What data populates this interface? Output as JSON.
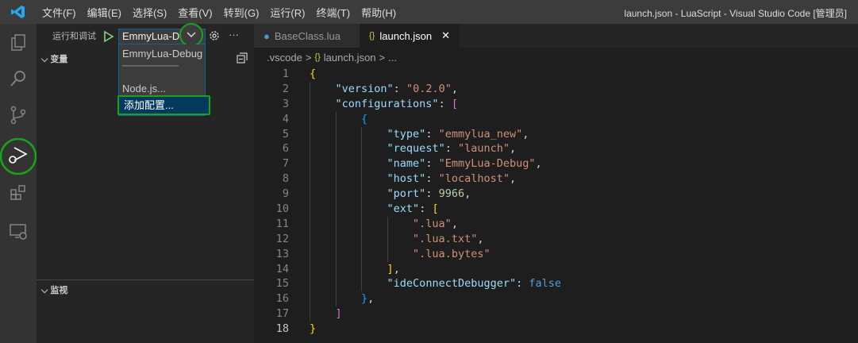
{
  "titlebar": {
    "menu": [
      "文件(F)",
      "编辑(E)",
      "选择(S)",
      "查看(V)",
      "转到(G)",
      "运行(R)",
      "终端(T)",
      "帮助(H)"
    ],
    "title": "launch.json - LuaScript - Visual Studio Code [管理员]"
  },
  "sidebar": {
    "title": "运行和调试",
    "config": "EmmyLua-Debug",
    "dropdown": {
      "items": [
        "EmmyLua-Debug",
        "──────────",
        "Node.js...",
        "添加配置..."
      ]
    },
    "more": "···",
    "variables": "变量",
    "watch": "监视"
  },
  "tabs": [
    {
      "label": "BaseClass.lua"
    },
    {
      "label": "launch.json",
      "close": "✕"
    }
  ],
  "breadcrumb": {
    "folder": ".vscode",
    "sep": ">",
    "file": "launch.json",
    "more": "..."
  },
  "editor": {
    "lines": [
      [
        [
          "{",
          "g"
        ]
      ],
      [
        [
          "    ",
          "p"
        ],
        [
          "\"version\"",
          "k"
        ],
        [
          ": ",
          "p"
        ],
        [
          "\"0.2.0\"",
          "s"
        ],
        [
          ",",
          "p"
        ]
      ],
      [
        [
          "    ",
          "p"
        ],
        [
          "\"configurations\"",
          "k"
        ],
        [
          ": ",
          "p"
        ],
        [
          "[",
          "m"
        ]
      ],
      [
        [
          "        ",
          "p"
        ],
        [
          "{",
          "c"
        ]
      ],
      [
        [
          "            ",
          "p"
        ],
        [
          "\"type\"",
          "k"
        ],
        [
          ": ",
          "p"
        ],
        [
          "\"emmylua_new\"",
          "s"
        ],
        [
          ",",
          "p"
        ]
      ],
      [
        [
          "            ",
          "p"
        ],
        [
          "\"request\"",
          "k"
        ],
        [
          ": ",
          "p"
        ],
        [
          "\"launch\"",
          "s"
        ],
        [
          ",",
          "p"
        ]
      ],
      [
        [
          "            ",
          "p"
        ],
        [
          "\"name\"",
          "k"
        ],
        [
          ": ",
          "p"
        ],
        [
          "\"EmmyLua-Debug\"",
          "s"
        ],
        [
          ",",
          "p"
        ]
      ],
      [
        [
          "            ",
          "p"
        ],
        [
          "\"host\"",
          "k"
        ],
        [
          ": ",
          "p"
        ],
        [
          "\"localhost\"",
          "s"
        ],
        [
          ",",
          "p"
        ]
      ],
      [
        [
          "            ",
          "p"
        ],
        [
          "\"port\"",
          "k"
        ],
        [
          ": ",
          "p"
        ],
        [
          "9966",
          "n"
        ],
        [
          ",",
          "p"
        ]
      ],
      [
        [
          "            ",
          "p"
        ],
        [
          "\"ext\"",
          "k"
        ],
        [
          ": ",
          "p"
        ],
        [
          "[",
          "g"
        ]
      ],
      [
        [
          "                ",
          "p"
        ],
        [
          "\".lua\"",
          "s"
        ],
        [
          ",",
          "p"
        ]
      ],
      [
        [
          "                ",
          "p"
        ],
        [
          "\".lua.txt\"",
          "s"
        ],
        [
          ",",
          "p"
        ]
      ],
      [
        [
          "                ",
          "p"
        ],
        [
          "\".lua.bytes\"",
          "s"
        ]
      ],
      [
        [
          "            ",
          "p"
        ],
        [
          "]",
          "g"
        ],
        [
          ",",
          "p"
        ]
      ],
      [
        [
          "            ",
          "p"
        ],
        [
          "\"ideConnectDebugger\"",
          "k"
        ],
        [
          ": ",
          "p"
        ],
        [
          "false",
          "b"
        ]
      ],
      [
        [
          "        ",
          "p"
        ],
        [
          "}",
          "c"
        ],
        [
          ",",
          "p"
        ]
      ],
      [
        [
          "    ",
          "p"
        ],
        [
          "]",
          "m"
        ]
      ],
      [
        [
          "}",
          "g"
        ]
      ]
    ],
    "current_line": 18
  }
}
